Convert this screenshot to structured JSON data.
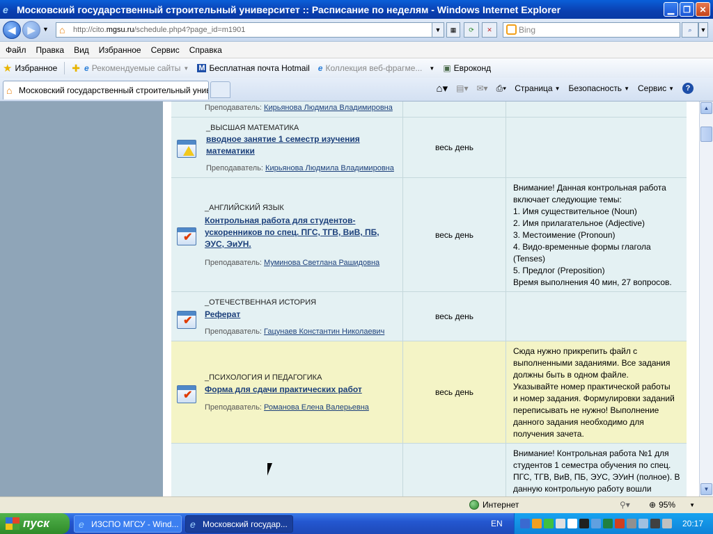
{
  "window": {
    "title": "Московский государственный строительный университет :: Расписание по неделям - Windows Internet Explorer"
  },
  "address": {
    "url_prefix": "http://cito.",
    "url_domain": "mgsu.ru",
    "url_suffix": "/schedule.php4?page_id=m1901",
    "search_placeholder": "Bing"
  },
  "menu": [
    "Файл",
    "Правка",
    "Вид",
    "Избранное",
    "Сервис",
    "Справка"
  ],
  "favorites": {
    "label": "Избранное",
    "items": [
      "Рекомендуемые сайты",
      "Бесплатная почта Hotmail",
      "Коллекция веб-фрагме...",
      "Евроконд"
    ]
  },
  "tab": {
    "title": "Московский государственный строительный унив..."
  },
  "commands": {
    "page": "Страница",
    "safety": "Безопасность",
    "tools": "Сервис"
  },
  "schedule": {
    "rows": [
      {
        "subject": "",
        "task": "",
        "teacher_label": "Преподаватель:",
        "teacher": "Кирьянова Людмила Владимировна",
        "time": "",
        "note": ""
      },
      {
        "subject": "_ВЫСШАЯ МАТЕМАТИКА",
        "task": "вводное занятие 1 семестр изучения математики",
        "teacher_label": "Преподаватель:",
        "teacher": "Кирьянова Людмила Владимировна",
        "time": "весь день",
        "note": ""
      },
      {
        "subject": "_АНГЛИЙСКИЙ ЯЗЫК",
        "task": "Контрольная работа для студентов-ускоренников по спец. ПГС, ТГВ, ВиВ, ПБ, ЭУС, ЭиУН.",
        "teacher_label": "Преподаватель:",
        "teacher": "Муминова Светлана Рашидовна",
        "time": "весь день",
        "note_lines": [
          "Внимание! Данная контрольная работа",
          "включает следующие темы:",
          "1. Имя существительное (Noun)",
          "2. Имя прилагательное (Adjective)",
          "3. Местоимение (Pronoun)",
          "4. Видо-временные формы глагола",
          "(Tenses)",
          "5. Предлог (Preposition)",
          "Время выполнения 40 мин, 27 вопросов."
        ]
      },
      {
        "subject": "_ОТЕЧЕСТВЕННАЯ ИСТОРИЯ",
        "task": "Реферат",
        "teacher_label": "Преподаватель:",
        "teacher": "Гацунаев Константин Николаевич",
        "time": "весь день",
        "note": ""
      },
      {
        "subject": "_ПСИХОЛОГИЯ И ПЕДАГОГИКА",
        "task": "Форма для сдачи практических работ",
        "teacher_label": "Преподаватель:",
        "teacher": "Романова Елена Валерьевна",
        "time": "весь день",
        "note_lines": [
          "Сюда нужно прикрепить файл с",
          "выполненными заданиями. Все задания",
          "должны быть в одном файле.",
          "Указывайте номер практической работы",
          "и номер задания. Формулировки заданий",
          "переписывать не нужно! Выполнение",
          "данного задания необходимо для",
          "получения зачета."
        ]
      },
      {
        "subject": "",
        "task": "",
        "teacher": "",
        "time": "",
        "note_lines": [
          "Внимание! Контрольная работа №1 для",
          "студентов 1 семестра обучения по спец.",
          "ПГС, ТГВ, ВиВ, ПБ, ЭУС, ЭУиН (полное). В",
          "данную контрольную работу вошли"
        ]
      }
    ]
  },
  "status": {
    "zone": "Интернет",
    "zoom": "95%"
  },
  "taskbar": {
    "start": "пуск",
    "buttons": [
      "ИЗСПО МГСУ - Wind...",
      "Московский государ..."
    ],
    "lang": "EN",
    "clock": "20:17"
  },
  "colors": {
    "row_bg": "#e4f1f3",
    "row_highlight": "#f4f4c6",
    "link": "#1b3f7a",
    "left_panel": "#8fa5b8"
  }
}
